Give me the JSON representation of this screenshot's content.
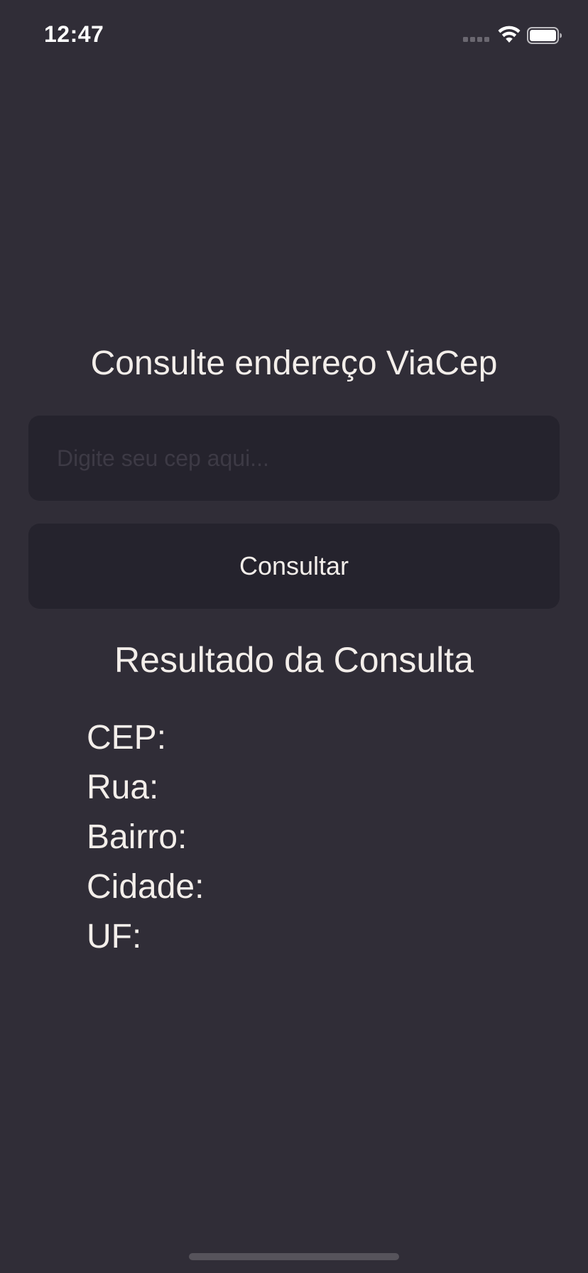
{
  "status_bar": {
    "time": "12:47"
  },
  "main": {
    "title": "Consulte endereço ViaCep",
    "cep_input": {
      "placeholder": "Digite seu cep aqui...",
      "value": ""
    },
    "consult_button_label": "Consultar"
  },
  "result": {
    "title": "Resultado da Consulta",
    "fields": [
      {
        "label": "CEP:"
      },
      {
        "label": "Rua:"
      },
      {
        "label": "Bairro:"
      },
      {
        "label": "Cidade:"
      },
      {
        "label": "UF:"
      }
    ]
  },
  "colors": {
    "background": "#302d37",
    "surface": "#25232d",
    "text": "#f3eeea"
  },
  "icons": [
    "signal-icon",
    "wifi-icon",
    "battery-icon"
  ]
}
